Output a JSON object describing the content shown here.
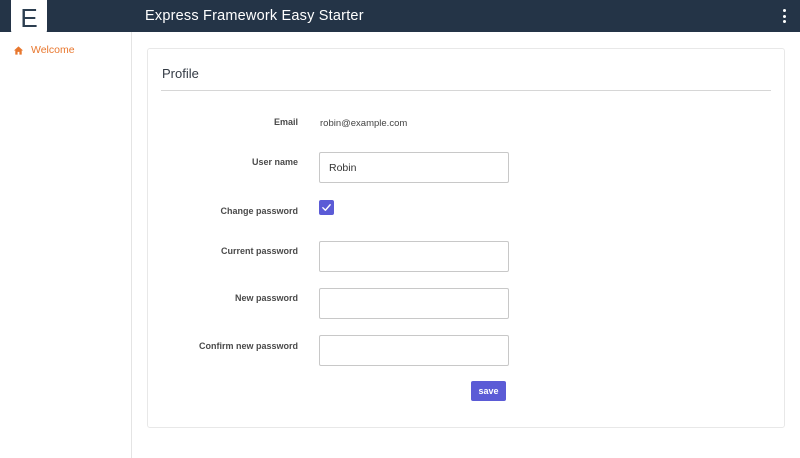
{
  "header": {
    "logo_letter": "E",
    "title": "Express Framework Easy Starter",
    "menu_icon": "kebab-menu-icon"
  },
  "sidebar": {
    "items": [
      {
        "label": "Welcome",
        "icon": "home-icon",
        "active": true
      }
    ]
  },
  "profile": {
    "title": "Profile",
    "fields": {
      "email": {
        "label": "Email",
        "value": "robin@example.com"
      },
      "username": {
        "label": "User name",
        "value": "Robin"
      },
      "change_password": {
        "label": "Change password",
        "checked": true
      },
      "current_password": {
        "label": "Current password",
        "value": ""
      },
      "new_password": {
        "label": "New password",
        "value": ""
      },
      "confirm_password": {
        "label": "Confirm new password",
        "value": ""
      }
    },
    "save_label": "save"
  },
  "colors": {
    "topbar": "#243447",
    "accent": "#5b5bd6",
    "nav_active": "#e8772e"
  }
}
